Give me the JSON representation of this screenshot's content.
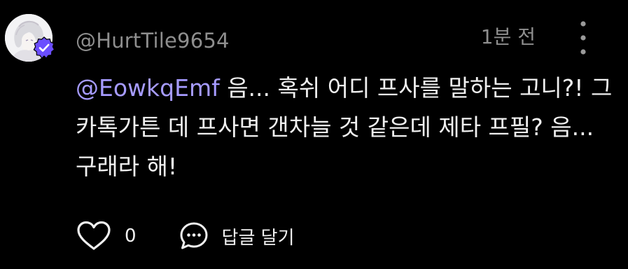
{
  "comment": {
    "author": "@HurtTile9654",
    "timestamp": "1분 전",
    "mention": "@EowkqEmf",
    "text": " 음... 혹쉬 어디 프사를 말하는 고니?! 그 카톡가튼 데 프사면 갠차늘 것 같은데 제타 프필? 음... 구래라 해!",
    "like_count": "0",
    "reply_label": "답글 달기",
    "verified": true
  },
  "colors": {
    "background": "#000000",
    "mention": "#a69bff",
    "muted": "#8e8e8e",
    "text": "#f0f0f0",
    "verified_badge": "#6b4eff"
  },
  "icons": {
    "more": "more-vertical-icon",
    "like": "heart-outline-icon",
    "reply": "speech-bubble-icon",
    "verified": "verified-badge-icon"
  }
}
